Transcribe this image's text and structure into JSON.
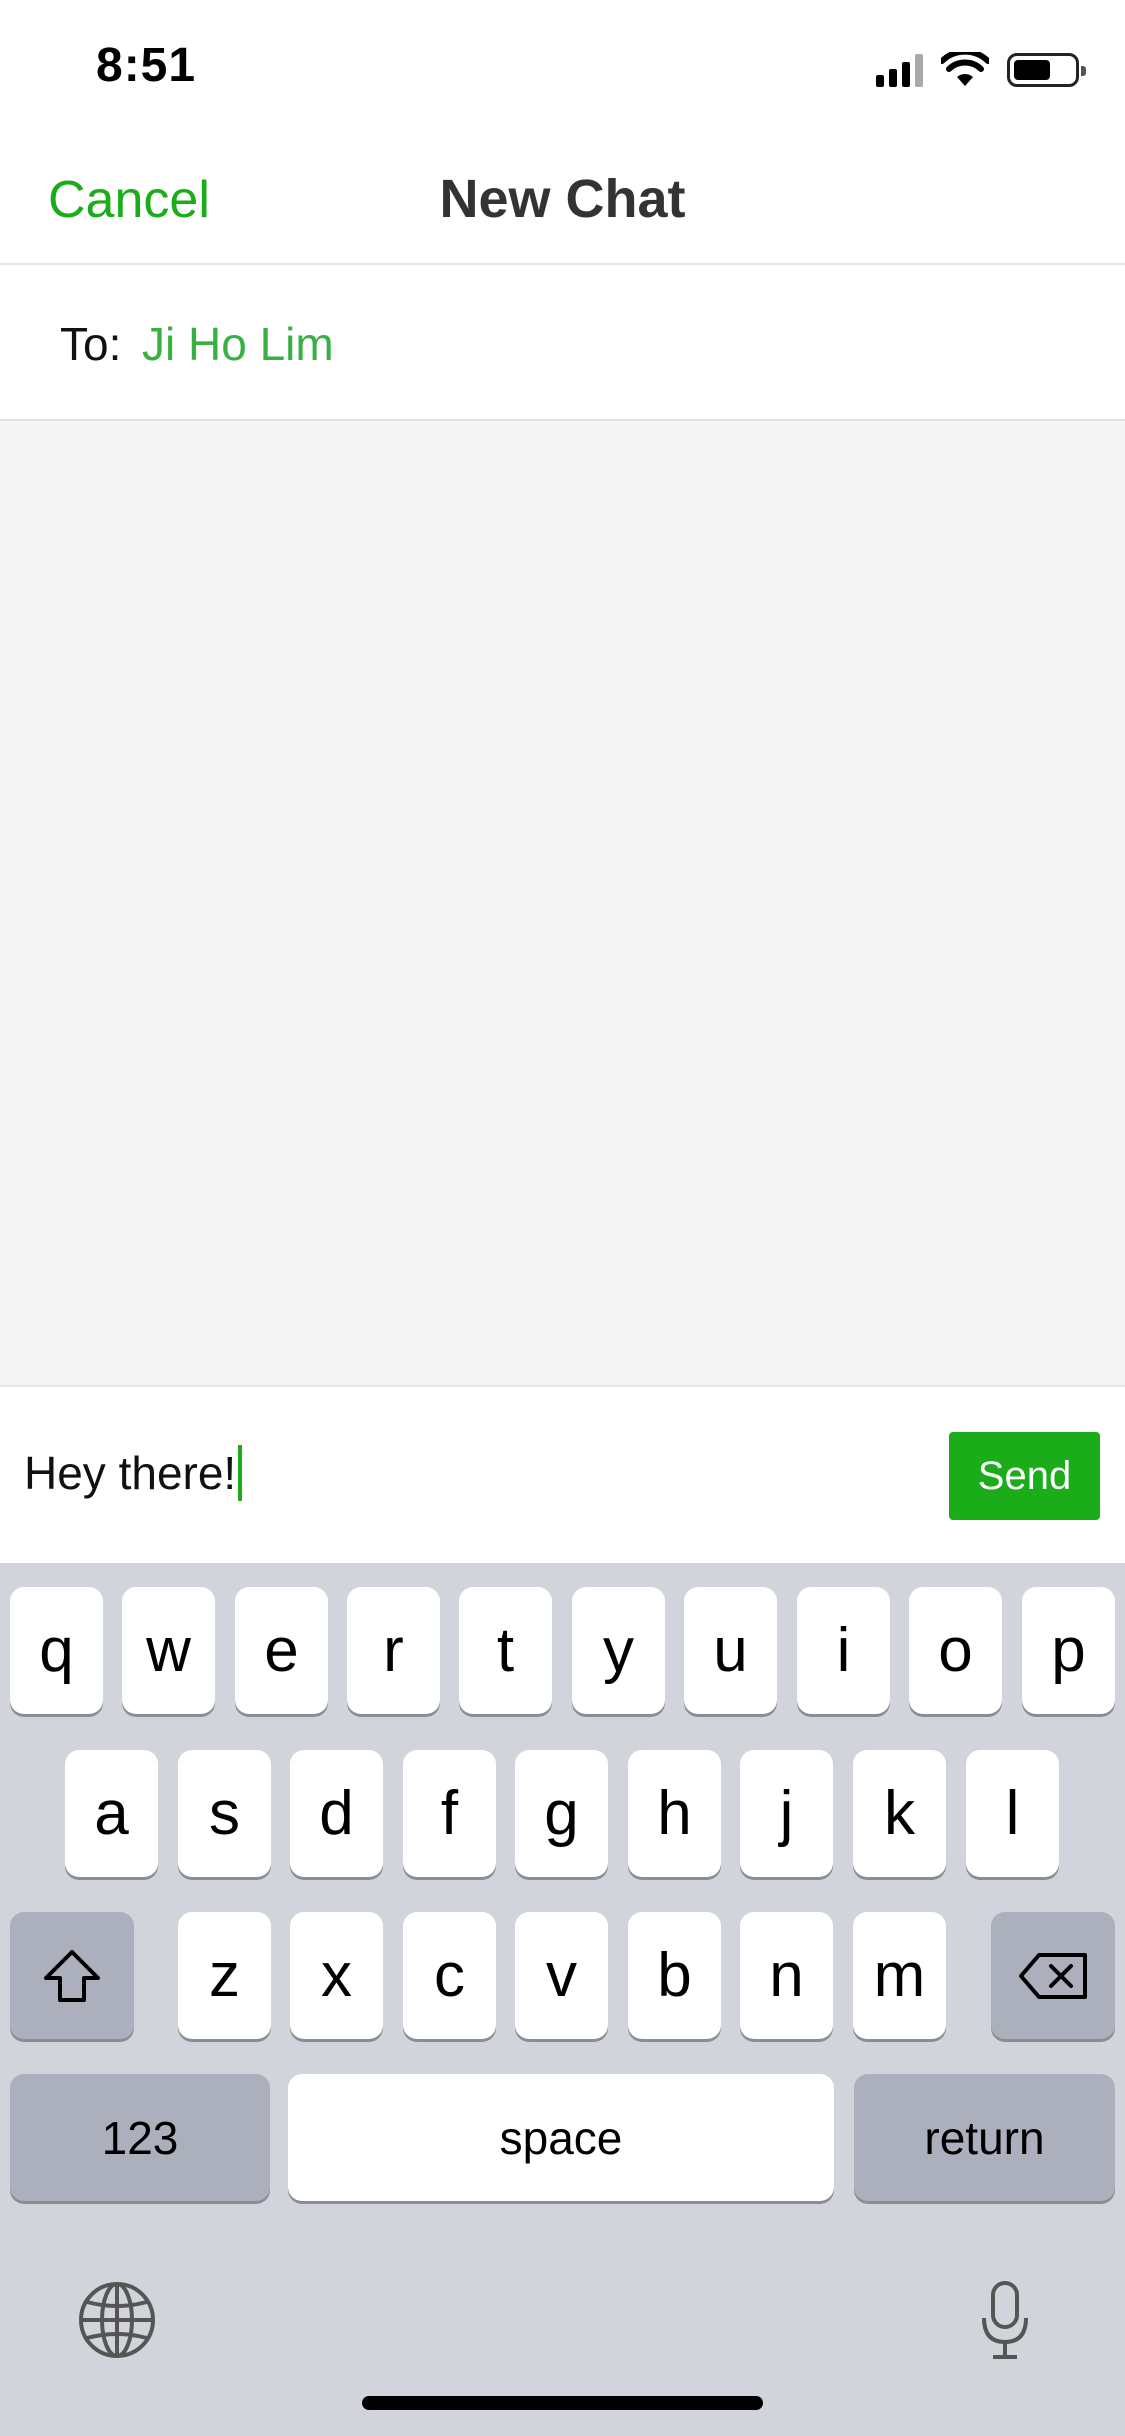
{
  "status_bar": {
    "time": "8:51"
  },
  "nav": {
    "cancel_label": "Cancel",
    "title": "New Chat"
  },
  "recipient": {
    "to_label": "To:",
    "name": "Ji Ho Lim"
  },
  "composer": {
    "message": "Hey there!",
    "send_label": "Send"
  },
  "keyboard": {
    "row1": [
      "q",
      "w",
      "e",
      "r",
      "t",
      "y",
      "u",
      "i",
      "o",
      "p"
    ],
    "row2": [
      "a",
      "s",
      "d",
      "f",
      "g",
      "h",
      "j",
      "k",
      "l"
    ],
    "row3": [
      "z",
      "x",
      "c",
      "v",
      "b",
      "n",
      "m"
    ],
    "numbers_label": "123",
    "space_label": "space",
    "return_label": "return"
  },
  "colors": {
    "accent": "#1aad19",
    "recipient": "#38b044",
    "keyboard_bg": "#d1d4db",
    "message_area_bg": "#f4f4f4"
  },
  "icons": [
    "signal-icon",
    "wifi-icon",
    "battery-icon",
    "shift-icon",
    "backspace-icon",
    "globe-icon",
    "microphone-icon"
  ]
}
